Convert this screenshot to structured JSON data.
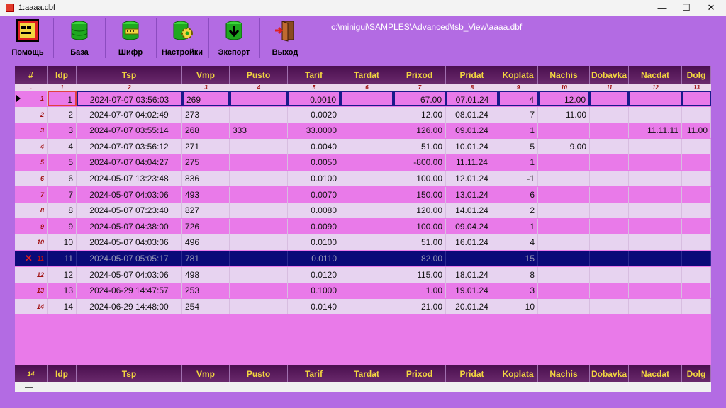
{
  "window": {
    "title": "1:aaaa.dbf",
    "min": "—",
    "max": "☐",
    "close": "✕"
  },
  "toolbar": {
    "buttons": [
      {
        "id": "help",
        "label": "Помощь"
      },
      {
        "id": "base",
        "label": "База"
      },
      {
        "id": "cipher",
        "label": "Шифр"
      },
      {
        "id": "settings",
        "label": "Настройки"
      },
      {
        "id": "export",
        "label": "Экспорт"
      },
      {
        "id": "exit",
        "label": "Выход"
      }
    ],
    "path": "c:\\minigui\\SAMPLES\\Advanced\\tsb_View\\aaaa.dbf"
  },
  "grid": {
    "columns": [
      "#",
      "Idp",
      "Tsp",
      "Vmp",
      "Pusto",
      "Tarif",
      "Tardat",
      "Prixod",
      "Pridat",
      "Koplata",
      "Nachis",
      "Dobavka",
      "Nacdat",
      "Dolg"
    ],
    "column_numbers": [
      ".",
      "1",
      "2",
      "3",
      "4",
      "5",
      "6",
      "7",
      "8",
      "9",
      "10",
      "11",
      "12",
      "13"
    ],
    "rows": [
      [
        "1",
        "1",
        "2024-07-07 03:56:03",
        "269",
        "",
        "0.0010",
        "",
        "67.00",
        "07.01.24",
        "4",
        "12.00",
        "",
        "",
        ""
      ],
      [
        "2",
        "2",
        "2024-07-07 04:02:49",
        "273",
        "",
        "0.0020",
        "",
        "12.00",
        "08.01.24",
        "7",
        "11.00",
        "",
        "",
        ""
      ],
      [
        "3",
        "3",
        "2024-07-07 03:55:14",
        "268",
        "333",
        "33.0000",
        "",
        "126.00",
        "09.01.24",
        "1",
        "",
        "",
        "11.11.11",
        "11.00"
      ],
      [
        "4",
        "4",
        "2024-07-07 03:56:12",
        "271",
        "",
        "0.0040",
        "",
        "51.00",
        "10.01.24",
        "5",
        "9.00",
        "",
        "",
        ""
      ],
      [
        "5",
        "5",
        "2024-07-07 04:04:27",
        "275",
        "",
        "0.0050",
        "",
        "-800.00",
        "11.11.24",
        "1",
        "",
        "",
        "",
        ""
      ],
      [
        "6",
        "6",
        "2024-05-07 13:23:48",
        "836",
        "",
        "0.0100",
        "",
        "100.00",
        "12.01.24",
        "-1",
        "",
        "",
        "",
        ""
      ],
      [
        "7",
        "7",
        "2024-05-07 04:03:06",
        "493",
        "",
        "0.0070",
        "",
        "150.00",
        "13.01.24",
        "6",
        "",
        "",
        "",
        ""
      ],
      [
        "8",
        "8",
        "2024-05-07 07:23:40",
        "827",
        "",
        "0.0080",
        "",
        "120.00",
        "14.01.24",
        "2",
        "",
        "",
        "",
        ""
      ],
      [
        "9",
        "9",
        "2024-05-07 04:38:00",
        "726",
        "",
        "0.0090",
        "",
        "100.00",
        "09.04.24",
        "1",
        "",
        "",
        "",
        ""
      ],
      [
        "10",
        "10",
        "2024-05-07 04:03:06",
        "496",
        "",
        "0.0100",
        "",
        "51.00",
        "16.01.24",
        "4",
        "",
        "",
        "",
        ""
      ],
      [
        "11",
        "11",
        "2024-05-07 05:05:17",
        "781",
        "",
        "0.0110",
        "",
        "82.00",
        "",
        "15",
        "",
        "",
        "",
        ""
      ],
      [
        "12",
        "12",
        "2024-05-07 04:03:06",
        "498",
        "",
        "0.0120",
        "",
        "115.00",
        "18.01.24",
        "8",
        "",
        "",
        "",
        ""
      ],
      [
        "13",
        "13",
        "2024-06-29 14:47:57",
        "253",
        "",
        "0.1000",
        "",
        "1.00",
        "19.01.24",
        "3",
        "",
        "",
        "",
        ""
      ],
      [
        "14",
        "14",
        "2024-06-29 14:48:00",
        "254",
        "",
        "0.0140",
        "",
        "21.00",
        "20.01.24",
        "10",
        "",
        "",
        "",
        ""
      ]
    ],
    "deleted_marker": "✕",
    "footer_count": "14",
    "footer_columns": [
      "Idp",
      "Tsp",
      "Vmp",
      "Pusto",
      "Tarif",
      "Tardat",
      "Prixod",
      "Pridat",
      "Koplata",
      "Nachis",
      "Dobavka",
      "Nacdat",
      "Dolg"
    ]
  },
  "colors": {
    "window_bg": "#b36be3",
    "header_text": "#f3d640",
    "row_pink": "#e97ae9",
    "row_light": "#e7d3f0",
    "selected_row": "#0a0a78"
  }
}
